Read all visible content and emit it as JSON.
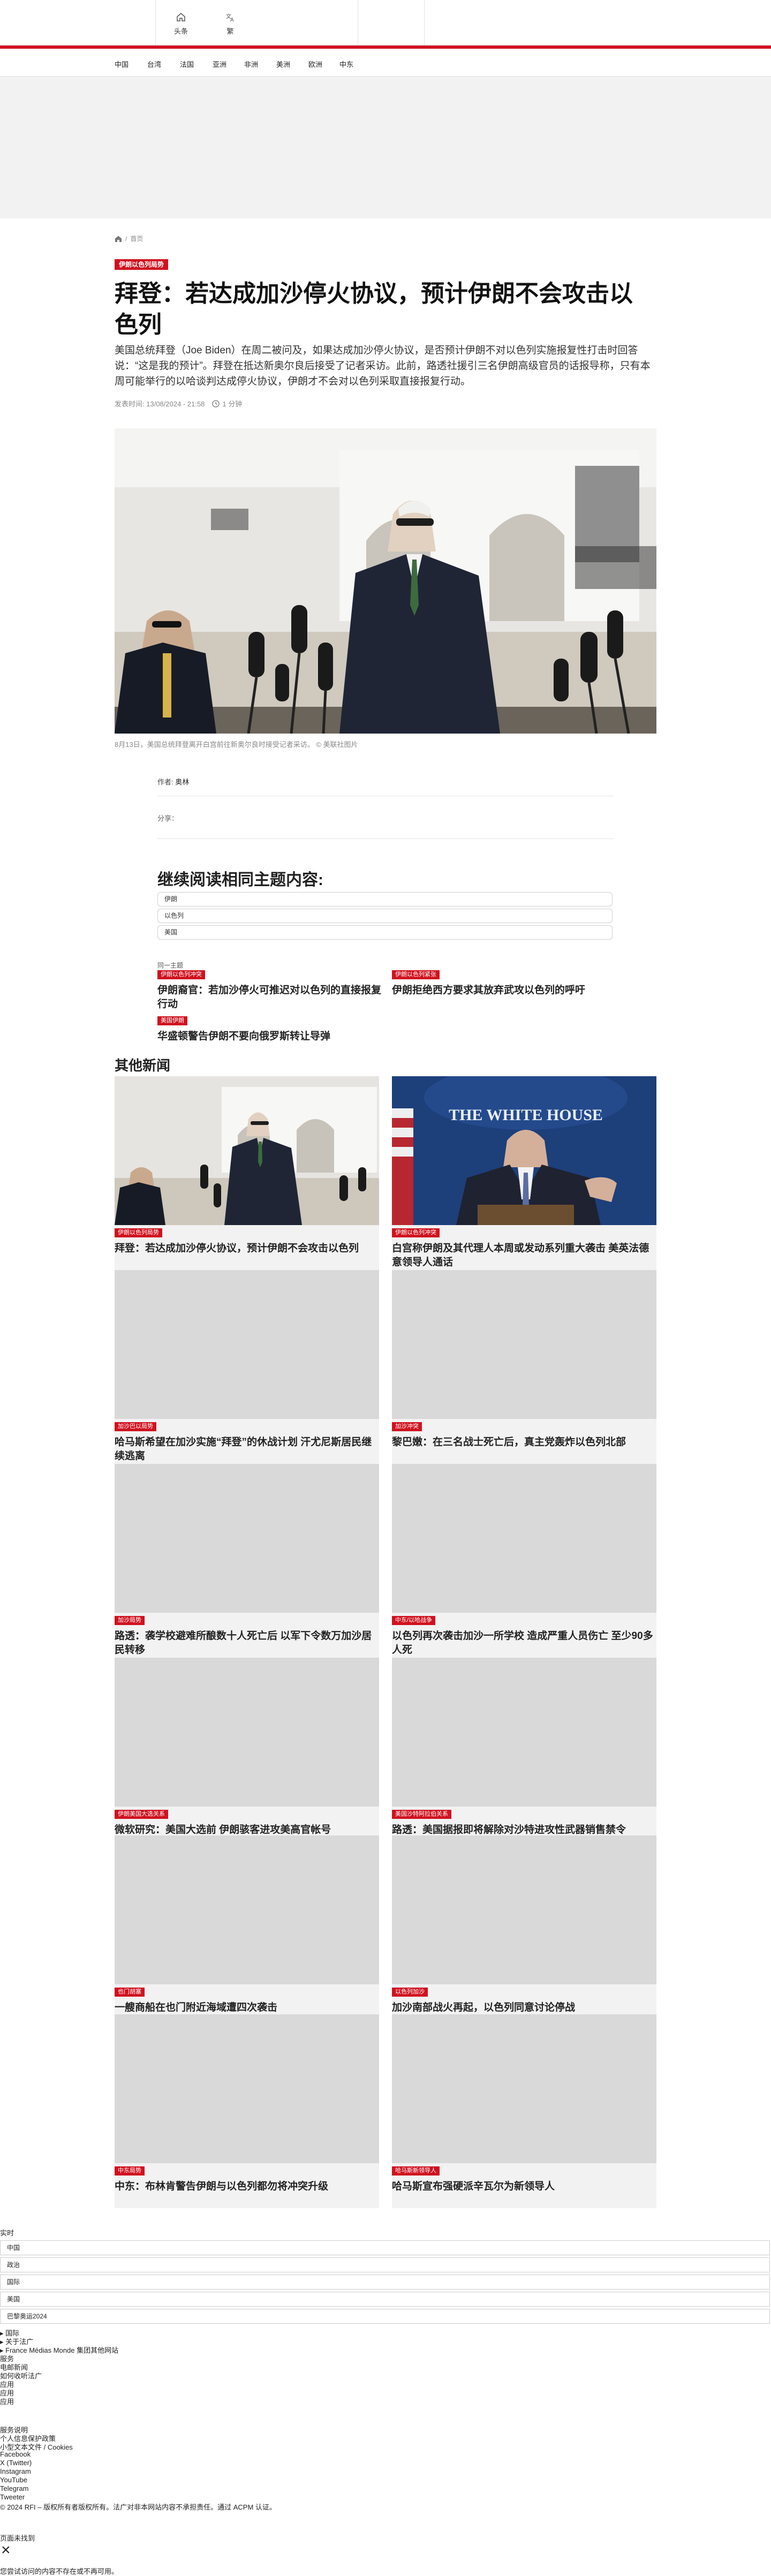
{
  "header": {
    "tools": [
      {
        "icon": "home-icon",
        "label": "头条"
      },
      {
        "icon": "translate-icon",
        "label": "繁"
      }
    ]
  },
  "nav": {
    "items": [
      "中国",
      "台湾",
      "法国",
      "亚洲",
      "非洲",
      "美洲",
      "欧洲",
      "中东"
    ]
  },
  "breadcrumb": {
    "home_icon": "home-icon",
    "current": "首页"
  },
  "article": {
    "tag": "伊朗以色列局势",
    "title": "拜登：若达成加沙停火协议，预计伊朗不会攻击以色列",
    "lead": "美国总统拜登（Joe Biden）在周二被问及，如果达成加沙停火协议，是否预计伊朗不对以色列实施报复性打击时回答说：“这是我的预计”。拜登在抵达新奥尔良后接受了记者采访。此前，路透社援引三名伊朗高级官员的话报导称，只有本周可能举行的以哈谈判达成停火协议，伊朗才不会对以色列采取直接报复行动。",
    "published_label": "发表时间:",
    "published": "13/08/2024 - 21:58",
    "read_time": "1 分钟",
    "caption": "8月13日，美国总统拜登离开白宫前往新奥尔良时接受记者采访。 © 美联社图片",
    "author_label": "作者:",
    "author": "奥林",
    "share_label": "分享："
  },
  "related": {
    "heading": "继续阅读相同主题内容:",
    "topics": [
      "伊朗",
      "以色列",
      "美国"
    ],
    "same_topic_label": "同一主题",
    "items": [
      {
        "tag": "伊朗以色列冲突",
        "title": "伊朗裔官：若加沙停火可推迟对以色列的直接报复行动"
      },
      {
        "tag": "伊朗以色列紧张",
        "title": "伊朗拒绝西方要求其放弃武攻以色列的呼吁"
      },
      {
        "tag": "美国伊朗",
        "title": "华盛顿警告伊朗不要向俄罗斯转让导弹"
      }
    ]
  },
  "other_news": {
    "heading": "其他新闻",
    "cards": [
      {
        "tag": "伊朗以色列局势",
        "title": "拜登：若达成加沙停火协议，预计伊朗不会攻击以色列",
        "image": "biden-photo"
      },
      {
        "tag": "伊朗以色列冲突",
        "title": "白宫称伊朗及其代理人本周或发动系列重大袭击 美英法德意领导人通话",
        "image": "whitehouse-briefing-photo"
      },
      {
        "tag": "加沙巴以局势",
        "title": "哈马斯希望在加沙实施“拜登”的休战计划 汗尤尼斯居民继续逃离",
        "image": ""
      },
      {
        "tag": "加沙冲突",
        "title": "黎巴嫩：在三名战士死亡后，真主党轰炸以色列北部",
        "image": ""
      },
      {
        "tag": "加沙局势",
        "title": "路透：袭学校避难所酿数十人死亡后 以军下令数万加沙居民转移",
        "image": ""
      },
      {
        "tag": "中东/以哈战争",
        "title": "以色列再次袭击加沙一所学校 造成严重人员伤亡 至少90多人死",
        "image": ""
      },
      {
        "tag": "伊朗美国大选关系",
        "title": "微软研究：美国大选前 伊朗骇客进攻美高官帐号",
        "image": ""
      },
      {
        "tag": "美国沙特阿拉伯关系",
        "title": "路透：美国据报即将解除对沙特进攻性武器销售禁令",
        "image": ""
      },
      {
        "tag": "也门胡塞",
        "title": "一艘商船在也门附近海域遭四次袭击",
        "image": ""
      },
      {
        "tag": "以色列加沙",
        "title": "加沙南部战火再起，以色列同意讨论停战",
        "image": ""
      },
      {
        "tag": "中东局势",
        "title": "中东：布林肯警告伊朗与以色列都勿将冲突升级",
        "image": ""
      },
      {
        "tag": "哈马斯新领导人",
        "title": "哈马斯宣布强硬派辛瓦尔为新领导人",
        "image": ""
      }
    ]
  },
  "footer": {
    "live_label": "实时",
    "selects": [
      "中国",
      "政治",
      "国际",
      "美国",
      "巴黎奥运2024"
    ],
    "intl_label": "国际",
    "about_label": "关于法广",
    "group_label": "France Médias Monde 集团其他网站",
    "links": [
      "服务",
      "电邮新闻",
      "如何收听法广",
      "应用",
      "应用",
      "应用"
    ],
    "legal": [
      "服务说明",
      "个人信息保护政策",
      "小型文本文件 / Cookies"
    ],
    "social": [
      "Facebook",
      "X (Twitter)",
      "Instagram",
      "YouTube",
      "Telegram",
      "Tweeter"
    ],
    "copyright": "© 2024 RFI – 版权所有者版权所有。法广对非本网站内容不承担责任。通过 ACPM 认证。",
    "not_found_label": "页面未找到",
    "not_found_text": "您尝试访问的内容不存在或不再可用。"
  },
  "colors": {
    "accent": "#d0121f",
    "card_bg": "#f2f2f2",
    "placeholder": "#d9d9d9"
  }
}
